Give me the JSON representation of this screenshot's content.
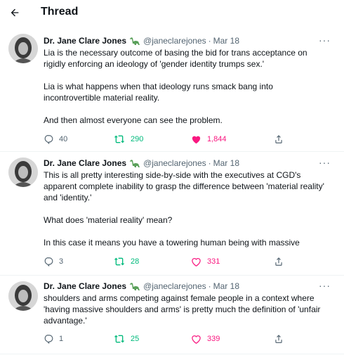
{
  "header": {
    "title": "Thread"
  },
  "tweets": [
    {
      "name": "Dr. Jane Clare Jones",
      "emoji": "sauropod-emoji",
      "handle": "@janeclarejones",
      "separator": "·",
      "date": "Mar 18",
      "more": "···",
      "paragraphs": [
        "Lia is the necessary outcome of basing the bid for trans acceptance on rigidly enforcing an ideology of 'gender identity trumps sex.'",
        "Lia is what happens when that ideology runs smack bang into incontrovertible material reality.",
        "And then almost everyone can see the problem."
      ],
      "replies": "40",
      "retweets": "290",
      "likes": "1,844",
      "liked": true
    },
    {
      "name": "Dr. Jane Clare Jones",
      "emoji": "sauropod-emoji",
      "handle": "@janeclarejones",
      "separator": "·",
      "date": "Mar 18",
      "more": "···",
      "paragraphs": [
        "This is all pretty interesting side-by-side with the executives at CGD's apparent complete inability to grasp the difference between 'material reality' and 'identity.'",
        "What does 'material reality' mean?",
        "In this case it means you have a towering human being with massive"
      ],
      "replies": "3",
      "retweets": "28",
      "likes": "331",
      "liked": false
    },
    {
      "name": "Dr. Jane Clare Jones",
      "emoji": "sauropod-emoji",
      "handle": "@janeclarejones",
      "separator": "·",
      "date": "Mar 18",
      "more": "···",
      "paragraphs": [
        "shoulders and arms competing against female people in a context where 'having massive shoulders and arms' is pretty much the definition of 'unfair advantage.'"
      ],
      "replies": "1",
      "retweets": "25",
      "likes": "339",
      "liked": false
    }
  ],
  "colors": {
    "text": "#0f1419",
    "muted": "#536471",
    "retweet": "#00ba7c",
    "like": "#f91880",
    "divider": "#eff3f4"
  },
  "icons": [
    "back-arrow-icon",
    "more-icon",
    "reply-icon",
    "retweet-icon",
    "heart-icon",
    "share-icon"
  ]
}
